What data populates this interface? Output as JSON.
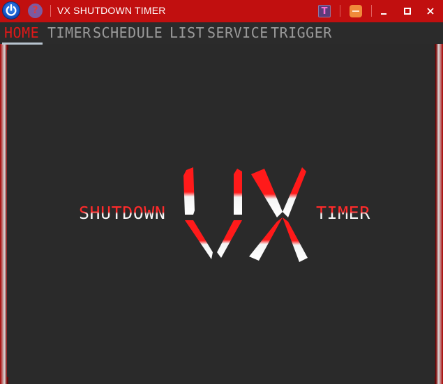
{
  "titlebar": {
    "title": "VX SHUTDOWN TIMER",
    "help_glyph": "?",
    "t_glyph": "T",
    "icons": [
      "power-icon",
      "help-icon",
      "t-icon",
      "orange-minimize-icon",
      "minimize-icon",
      "maximize-icon",
      "close-icon"
    ],
    "minimize_glyph": "–",
    "maximize_glyph": "□",
    "close_glyph": "✕"
  },
  "menu": {
    "tabs": [
      {
        "label": "HOME",
        "active": true
      },
      {
        "label": "TIMER",
        "active": false
      },
      {
        "label": "SCHEDULE",
        "active": false
      },
      {
        "label": "LIST",
        "active": false
      },
      {
        "label": "SERVICE",
        "active": false
      },
      {
        "label": "TRIGGER",
        "active": false
      }
    ]
  },
  "logo": {
    "left_word": "SHUTDOWN",
    "mark": "VX",
    "right_word": "TIMER"
  },
  "colors": {
    "accent": "#e01818",
    "titlebar": "#c10f0f",
    "background": "#2a2a2a",
    "tab_inactive": "#9a9a9a"
  }
}
